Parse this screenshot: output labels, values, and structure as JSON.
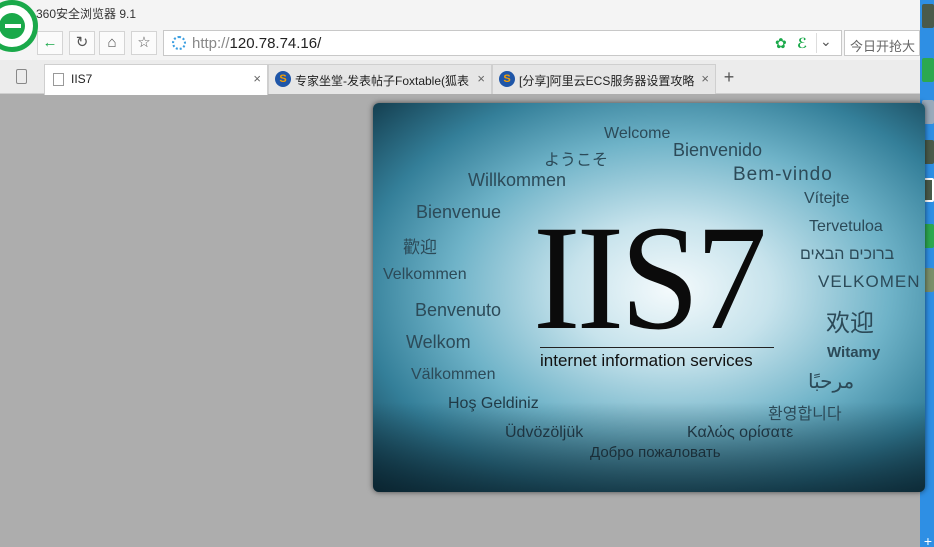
{
  "window": {
    "title": "360安全浏览器 9.1"
  },
  "toolbar": {
    "back_label": "←",
    "refresh_label": "↻",
    "home_label": "⌂",
    "favorite_label": "☆",
    "url_scheme": "http://",
    "url_host": "120.78.74.16/",
    "dropdown_label": "⌄",
    "search_placeholder": "今日开抢大"
  },
  "tabs": [
    {
      "label": "IIS7",
      "active": true,
      "icon": "page-icon"
    },
    {
      "label": "专家坐堂-发表帖子Foxtable(狐表",
      "active": false,
      "icon": "foxtable-icon"
    },
    {
      "label": "[分享]阿里云ECS服务器设置攻略",
      "active": false,
      "icon": "foxtable-icon"
    }
  ],
  "tab_close_label": "×",
  "new_tab_label": "+",
  "iis": {
    "logo": "IIS7",
    "subtitle": "internet information services",
    "words": [
      "Welcome",
      "ようこそ",
      "Bienvenido",
      "Willkommen",
      "Bem-vindo",
      "Vítejte",
      "Bienvenue",
      "Tervetuloa",
      "歡迎",
      "ברוכים הבאים",
      "Velkommen",
      "VELKOMEN",
      "Benvenuto",
      "欢迎",
      "Welkom",
      "Witamy",
      "Välkommen",
      "مرحبًا",
      "Hoş Geldiniz",
      "환영합니다",
      "Üdvözöljük",
      "Καλώς ορίσατε",
      "Добро пожаловать"
    ]
  },
  "colors": {
    "brand_green": "#1aa94a",
    "sidebar_blue": "#2e8fe4",
    "page_bg": "#adadad"
  }
}
